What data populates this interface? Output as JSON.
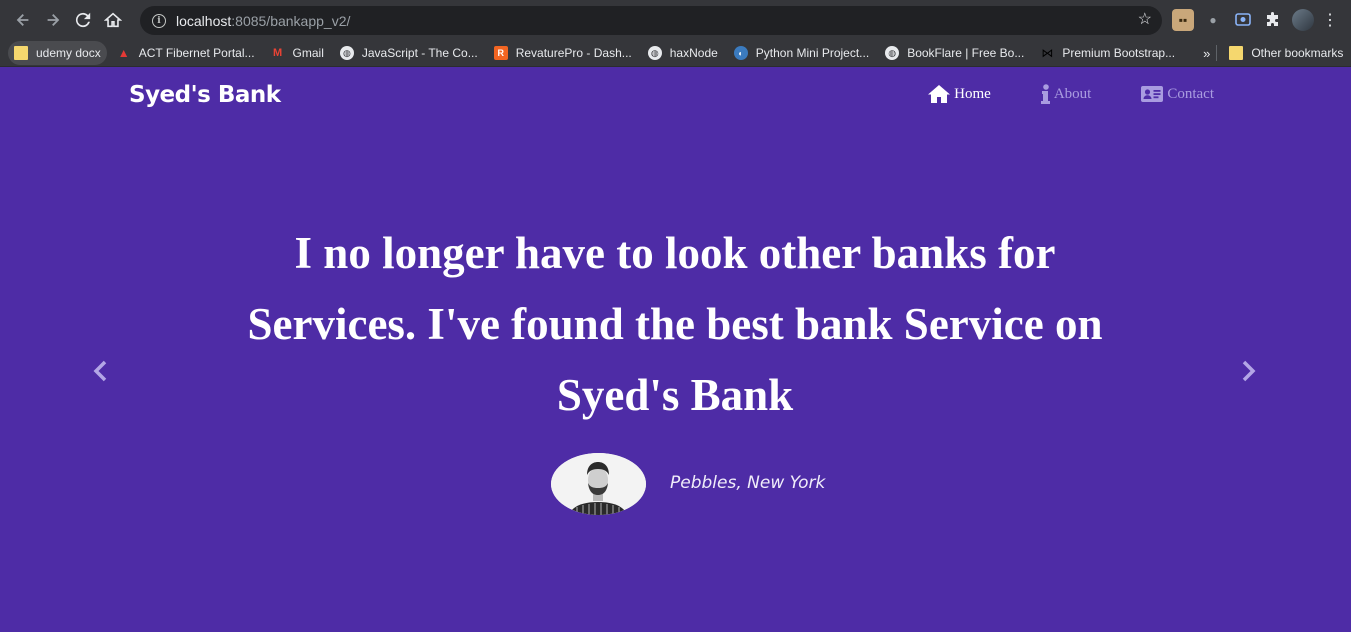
{
  "browser": {
    "url_host": "localhost",
    "url_rest": ":8085/bankapp_v2/",
    "bookmarks": [
      {
        "label": "udemy docx",
        "icon": "folder-icon"
      },
      {
        "label": "ACT Fibernet Portal...",
        "icon": "act-logo-icon"
      },
      {
        "label": "Gmail",
        "icon": "gmail-icon"
      },
      {
        "label": "JavaScript - The Co...",
        "icon": "globe-icon"
      },
      {
        "label": "RevaturePro - Dash...",
        "icon": "revature-icon"
      },
      {
        "label": "haxNode",
        "icon": "globe-icon"
      },
      {
        "label": "Python Mini Project...",
        "icon": "python-icon"
      },
      {
        "label": "BookFlare | Free Bo...",
        "icon": "globe-icon"
      },
      {
        "label": "Premium Bootstrap...",
        "icon": "bowtie-icon"
      }
    ],
    "more_label": "»",
    "other_bookmarks": "Other bookmarks"
  },
  "site": {
    "brand": "Syed's Bank",
    "nav": [
      {
        "label": "Home",
        "icon": "home-icon",
        "active": true
      },
      {
        "label": "About",
        "icon": "info-icon",
        "active": false
      },
      {
        "label": "Contact",
        "icon": "contact-card-icon",
        "active": false
      }
    ]
  },
  "testimonial": {
    "quote": "I no longer have to look other banks for Services. I've found the best bank Service on Syed's Bank",
    "author": "Pebbles, New York"
  },
  "colors": {
    "background": "#4e2ca6",
    "nav_active": "#ffffff",
    "nav_inactive": "#a99ce0"
  }
}
